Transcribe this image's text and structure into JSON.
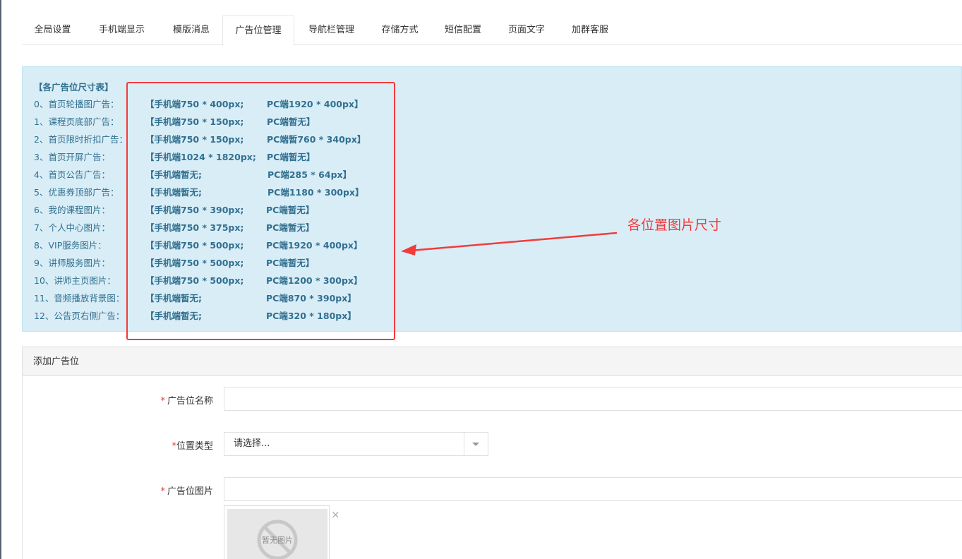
{
  "tabs": [
    {
      "label": "全局设置",
      "active": false
    },
    {
      "label": "手机端显示",
      "active": false
    },
    {
      "label": "模版消息",
      "active": false
    },
    {
      "label": "广告位管理",
      "active": true
    },
    {
      "label": "导航栏管理",
      "active": false
    },
    {
      "label": "存储方式",
      "active": false
    },
    {
      "label": "短信配置",
      "active": false
    },
    {
      "label": "页面文字",
      "active": false
    },
    {
      "label": "加群客服",
      "active": false
    }
  ],
  "size_table": {
    "title": "【各广告位尺寸表】",
    "rows": [
      {
        "label": "0、首页轮播图广告：",
        "mobile": "【手机端750 * 400px;",
        "pc": "PC端1920 * 400px】"
      },
      {
        "label": "1、课程页底部广告：",
        "mobile": "【手机端750 * 150px;",
        "pc": "PC端暂无】"
      },
      {
        "label": "2、首页限时折扣广告：",
        "mobile": "【手机端750 * 150px;",
        "pc": "PC端暂760 * 340px】"
      },
      {
        "label": "3、首页开屏广告：",
        "mobile": "【手机端1024 * 1820px;",
        "pc": "PC端暂无】"
      },
      {
        "label": "4、首页公告广告：",
        "mobile": "【手机端暂无;",
        "pc": "PC端285 * 64px】"
      },
      {
        "label": "5、优惠券顶部广告：",
        "mobile": "【手机端暂无;",
        "pc": "PC端1180 * 300px】"
      },
      {
        "label": "6、我的课程图片：",
        "mobile": "【手机端750 * 390px;",
        "pc": "PC端暂无】"
      },
      {
        "label": "7、个人中心图片：",
        "mobile": "【手机端750 * 375px;",
        "pc": "PC端暂无】"
      },
      {
        "label": "8、VIP服务图片：",
        "mobile": "【手机端750 * 500px;",
        "pc": "PC端1920 * 400px】"
      },
      {
        "label": "9、讲师服务图片：",
        "mobile": "【手机端750 * 500px;",
        "pc": "PC端暂无】"
      },
      {
        "label": "10、讲师主页图片：",
        "mobile": "【手机端750 * 500px;",
        "pc": "PC端1200 * 300px】"
      },
      {
        "label": "11、音频播放背景图：",
        "mobile": "【手机端暂无;",
        "pc": "PC端870 * 390px】"
      },
      {
        "label": "12、公告页右侧广告：",
        "mobile": "【手机端暂无;",
        "pc": "PC端320 * 180px】"
      }
    ]
  },
  "annotation": {
    "text": "各位置图片尺寸",
    "color": "#f03c3c"
  },
  "form": {
    "panel_title": "添加广告位",
    "required_mark": "*",
    "name_label": "广告位名称",
    "name_value": "",
    "type_label": "位置类型",
    "type_selected": "请选择...",
    "image_label": "广告位图片",
    "image_value": "",
    "no_image_text": "暂无图片",
    "remove_glyph": "×"
  },
  "colors": {
    "info_bg": "#d9edf7",
    "info_text": "#31708f",
    "required": "#e4393c"
  }
}
